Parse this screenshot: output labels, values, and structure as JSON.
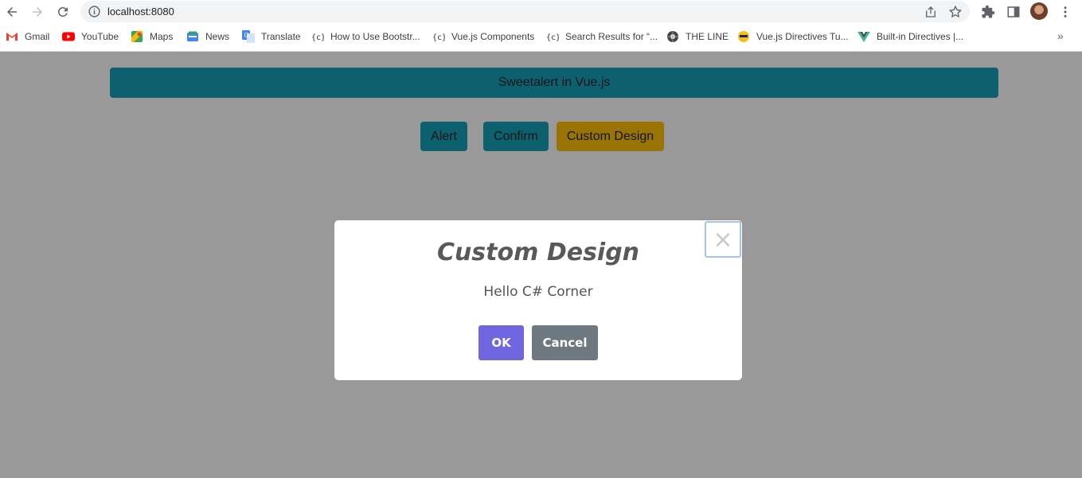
{
  "browser": {
    "url": "localhost:8080",
    "bookmarks": [
      {
        "label": "Gmail",
        "icon": "gmail-icon"
      },
      {
        "label": "YouTube",
        "icon": "youtube-icon"
      },
      {
        "label": "Maps",
        "icon": "maps-icon"
      },
      {
        "label": "News",
        "icon": "news-icon"
      },
      {
        "label": "Translate",
        "icon": "translate-icon"
      },
      {
        "label": "How to Use Bootstr...",
        "icon": "csharp-corner-icon"
      },
      {
        "label": "Vue.js Components",
        "icon": "csharp-corner-icon"
      },
      {
        "label": "Search Results for “...",
        "icon": "csharp-corner-icon"
      },
      {
        "label": "THE LINE",
        "icon": "the-line-icon"
      },
      {
        "label": "Vue.js Directives Tu...",
        "icon": "site-icon"
      },
      {
        "label": "Built-in Directives |...",
        "icon": "vue-icon"
      }
    ],
    "more_bookmarks": "»"
  },
  "page": {
    "banner_title": "Sweetalert in Vue.js",
    "buttons": {
      "alert": "Alert",
      "confirm": "Confirm",
      "custom": "Custom Design"
    }
  },
  "modal": {
    "title": "Custom Design",
    "text": "Hello C# Corner",
    "close_symbol": "×",
    "ok_label": "OK",
    "cancel_label": "Cancel"
  },
  "colors": {
    "info": "#17a2b8",
    "warning": "#ffc107",
    "ok": "#7066e0",
    "cancel": "#6e7881",
    "overlay": "rgba(0,0,0,0.4)"
  }
}
